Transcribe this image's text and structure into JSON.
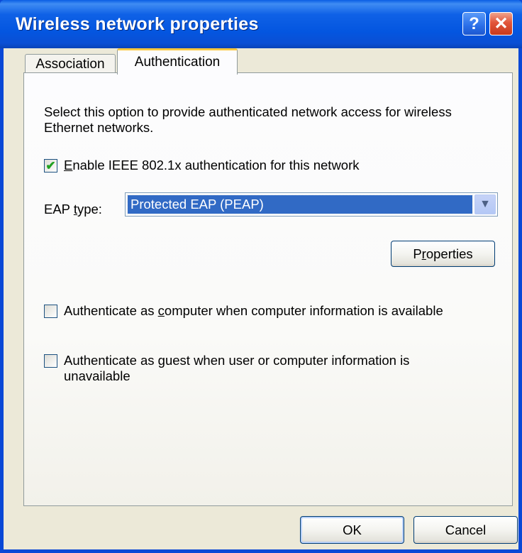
{
  "window": {
    "title": "Wireless network properties"
  },
  "titlebar_buttons": {
    "help": "?",
    "close": "✕"
  },
  "tabs": [
    {
      "label": "Association",
      "selected": false
    },
    {
      "label": "Authentication",
      "selected": true
    }
  ],
  "authentication": {
    "description": "Select this option to provide authenticated network access for wireless Ethernet networks.",
    "enable_8021x": {
      "label_accel": "E",
      "label_rest": "nable IEEE 802.1x authentication for this network",
      "checked": true
    },
    "eap_type": {
      "label_before": "EAP ",
      "label_accel": "t",
      "label_after": "ype:",
      "value": "Protected EAP (PEAP)"
    },
    "properties_button": {
      "accel": "r",
      "before": "P",
      "after": "operties"
    },
    "auth_as_computer": {
      "before": "Authenticate as ",
      "accel": "c",
      "after": "omputer when computer information is available",
      "checked": false
    },
    "auth_as_guest": {
      "before": "Authenticate as ",
      "accel": "g",
      "after": "uest when user or computer information is",
      "line2": "unavailable",
      "checked": false
    }
  },
  "footer": {
    "ok_label": "OK",
    "cancel_label": "Cancel"
  },
  "colors": {
    "title_bar": "#0a5ee4",
    "selection": "#316ac5",
    "tab_highlight": "#ffc83c",
    "dialog_bg": "#ece9d8"
  }
}
